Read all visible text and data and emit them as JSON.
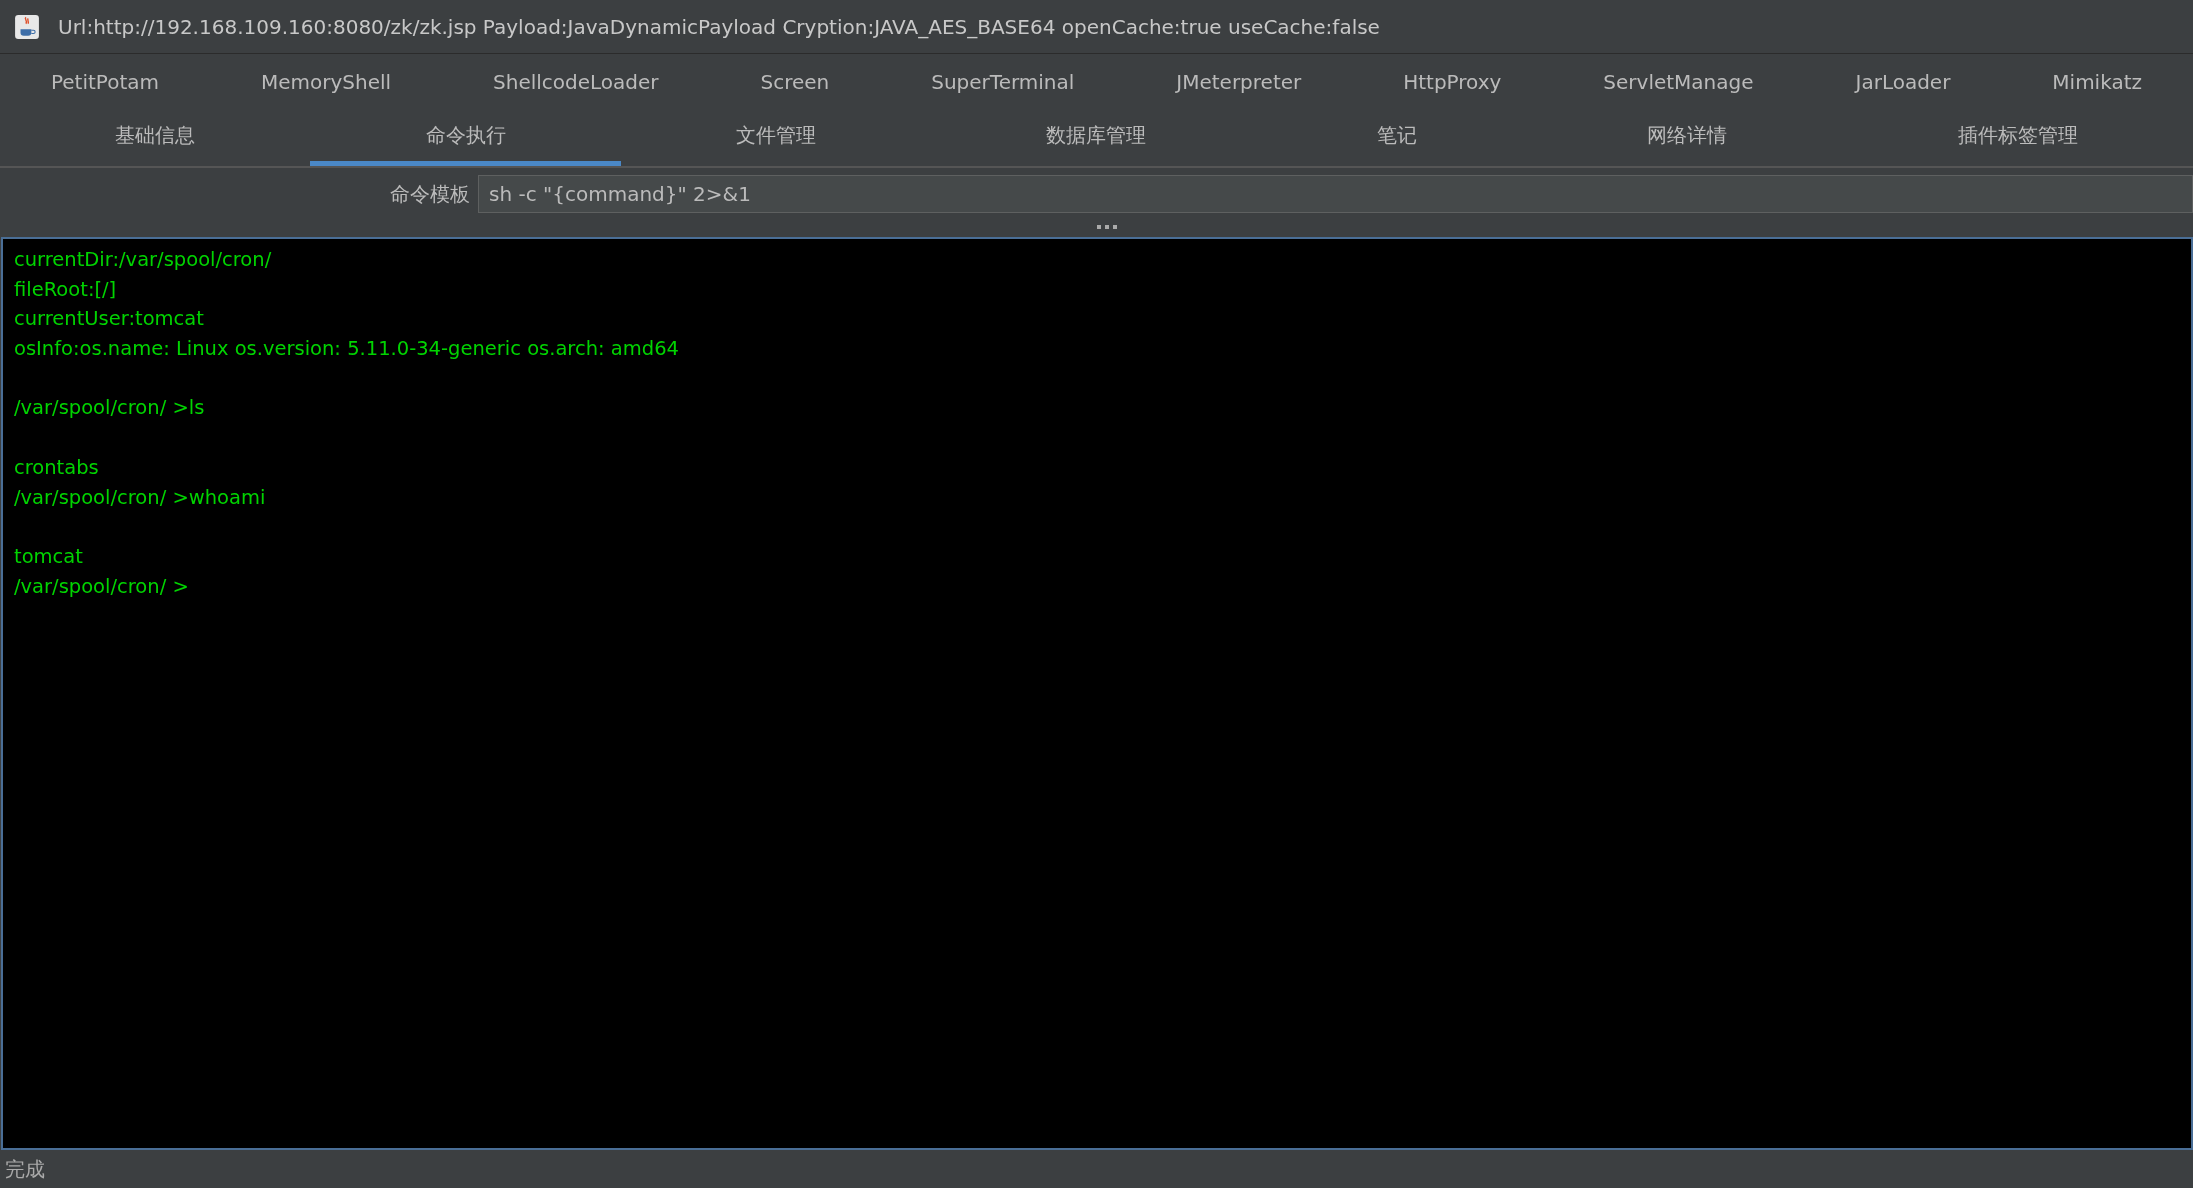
{
  "window": {
    "title": "Url:http://192.168.109.160:8080/zk/zk.jsp Payload:JavaDynamicPayload Cryption:JAVA_AES_BASE64 openCache:true useCache:false"
  },
  "plugin_tabs": [
    {
      "label": "PetitPotam",
      "selected": false
    },
    {
      "label": "MemoryShell",
      "selected": false
    },
    {
      "label": "ShellcodeLoader",
      "selected": false
    },
    {
      "label": "Screen",
      "selected": false
    },
    {
      "label": "SuperTerminal",
      "selected": false
    },
    {
      "label": "JMeterpreter",
      "selected": false
    },
    {
      "label": "HttpProxy",
      "selected": false
    },
    {
      "label": "ServletManage",
      "selected": false
    },
    {
      "label": "JarLoader",
      "selected": false
    },
    {
      "label": "Mimikatz",
      "selected": false
    }
  ],
  "tabs": [
    {
      "label": "基础信息",
      "selected": false
    },
    {
      "label": "命令执行",
      "selected": true
    },
    {
      "label": "文件管理",
      "selected": false
    },
    {
      "label": "数据库管理",
      "selected": false
    },
    {
      "label": "笔记",
      "selected": false
    },
    {
      "label": "网络详情",
      "selected": false
    },
    {
      "label": "插件标签管理",
      "selected": false
    }
  ],
  "command_template": {
    "label": "命令模板",
    "value": "sh -c \"{command}\" 2>&1"
  },
  "terminal": {
    "blocks": [
      {
        "lines": [
          "currentDir:/var/spool/cron/",
          "fileRoot:[/]",
          "currentUser:tomcat",
          "osInfo:os.name: Linux os.version: 5.11.0-34-generic os.arch: amd64"
        ]
      },
      {
        "lines": [
          "/var/spool/cron/ >ls"
        ]
      },
      {
        "lines": [
          "crontabs",
          "/var/spool/cron/ >whoami"
        ]
      },
      {
        "lines": [
          "tomcat",
          "/var/spool/cron/ >"
        ]
      }
    ]
  },
  "status_bar": {
    "text": "完成"
  }
}
